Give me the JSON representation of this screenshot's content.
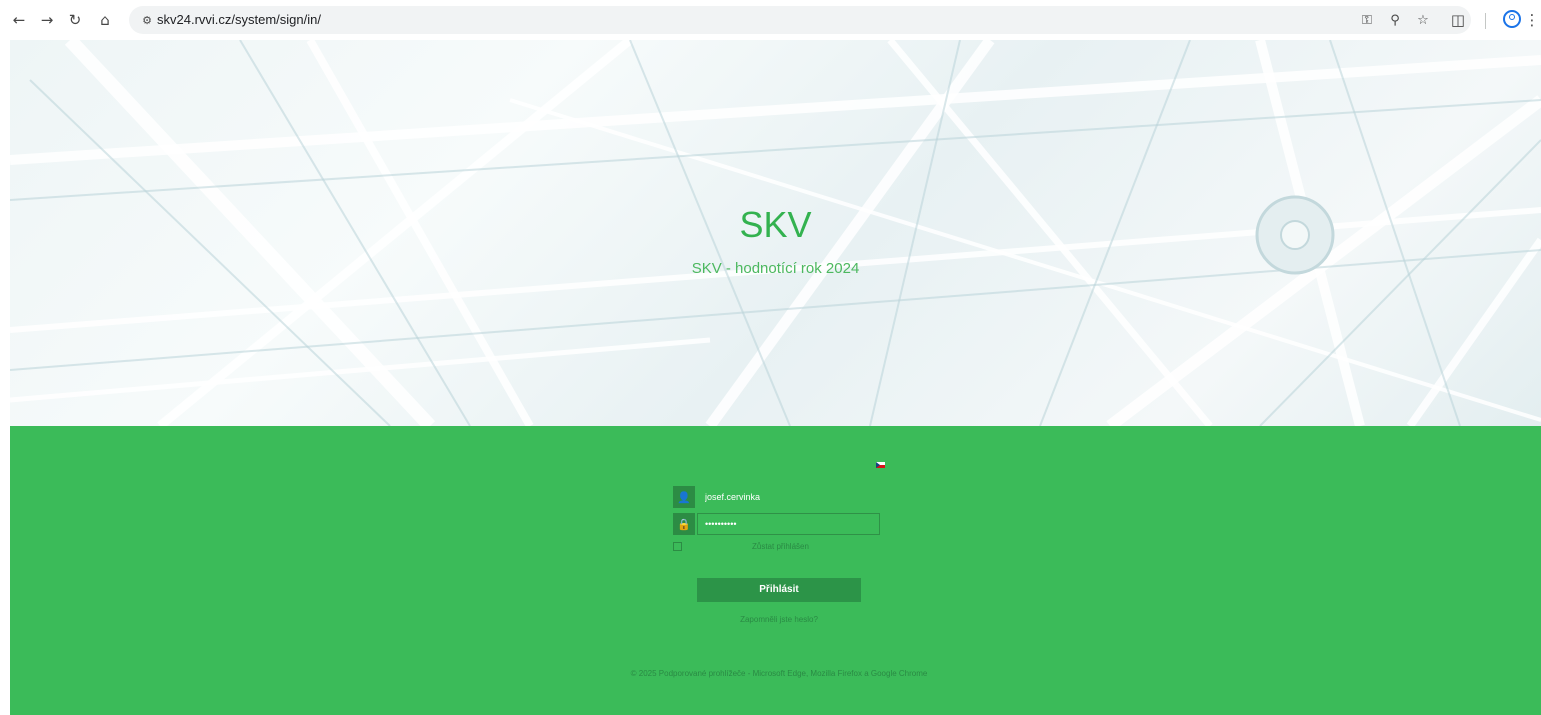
{
  "browser": {
    "url": "skv24.rvvi.cz/system/sign/in/",
    "icons": [
      "back-icon",
      "forward-icon",
      "reload-icon",
      "home-icon",
      "site-info-icon",
      "password-key-icon",
      "zoom-icon",
      "bookmark-star-icon",
      "extensions-icon",
      "profile-icon",
      "menu-icon"
    ]
  },
  "hero": {
    "title": "SKV",
    "subtitle": "SKV - hodnotící rok 2024"
  },
  "login": {
    "language_flag": "cs",
    "username_value": "josef.cervinka",
    "password_value": "••••••••••",
    "remember_label": "Zůstat přihlášen",
    "submit_label": "Přihlásit",
    "forgot_label": "Zapomněli jste heslo?"
  },
  "footer": {
    "text": "© 2025 Podporované prohlížeče - Microsoft Edge, Mozilla Firefox a Google Chrome"
  },
  "colors": {
    "brand_green": "#3bbb59",
    "dark_green": "#2c8c44",
    "title_green": "#33b24f"
  }
}
